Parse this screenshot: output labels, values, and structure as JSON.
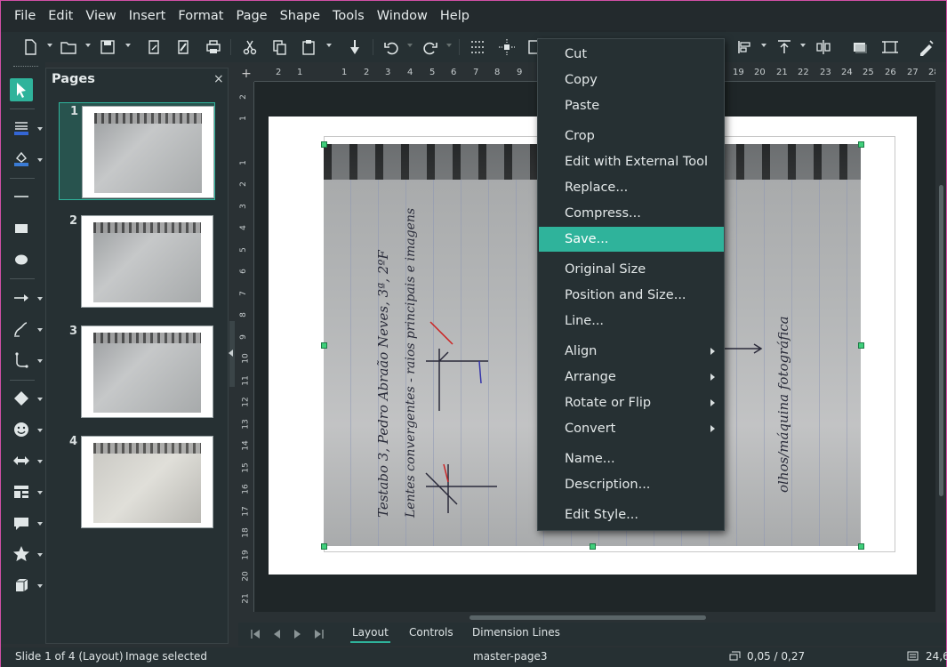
{
  "menubar": {
    "items": [
      "File",
      "Edit",
      "View",
      "Insert",
      "Format",
      "Page",
      "Shape",
      "Tools",
      "Window",
      "Help"
    ]
  },
  "toolbar": {
    "icons": [
      "new-icon",
      "open-icon",
      "save-icon",
      "export-icon",
      "export-pdf-icon",
      "print-icon",
      "cut-icon",
      "copy-icon",
      "paste-icon",
      "clone-formatting-icon",
      "undo-icon",
      "redo-icon",
      "grid-icon",
      "helplines-icon",
      "zoom-icon",
      "align-icon",
      "arrange-icon",
      "distribute-icon",
      "shadow-icon",
      "crop-icon",
      "transform-icon"
    ]
  },
  "tools": {
    "icons": [
      "select-icon",
      "line-color-icon",
      "fill-color-icon",
      "line-icon",
      "rectangle-icon",
      "ellipse-icon",
      "arrow-line-icon",
      "curve-icon",
      "connector-icon",
      "diamond-icon",
      "smiley-icon",
      "double-arrow-icon",
      "flowchart-icon",
      "callout-icon",
      "star-icon",
      "3d-cube-icon"
    ]
  },
  "pages_panel": {
    "title": "Pages",
    "close": "×",
    "thumbnails": [
      {
        "number": "1",
        "selected": true
      },
      {
        "number": "2",
        "selected": false
      },
      {
        "number": "3",
        "selected": false
      },
      {
        "number": "4",
        "selected": false
      }
    ]
  },
  "rulers": {
    "horizontal": [
      "2",
      "1",
      "1",
      "2",
      "3",
      "4",
      "5",
      "6",
      "7",
      "8",
      "9",
      "19",
      "20",
      "21",
      "22",
      "23",
      "24",
      "25",
      "26",
      "27",
      "28"
    ],
    "vertical": [
      "2",
      "1",
      "1",
      "2",
      "3",
      "4",
      "5",
      "6",
      "7",
      "8",
      "9",
      "10",
      "11",
      "12",
      "13",
      "14",
      "15",
      "16",
      "17",
      "18",
      "19",
      "20",
      "21"
    ]
  },
  "image": {
    "handwriting_title": "Testabo 3, Pedro Abraão Neves, 3ª, 2ºF",
    "handwriting_subtitle": "Lentes convergentes - raios principais e imagens",
    "handwriting_right": "olhos/máquina fotográfica"
  },
  "context_menu": {
    "items": [
      {
        "label": "Cut"
      },
      {
        "label": "Copy"
      },
      {
        "label": "Paste"
      },
      {
        "label": "Crop"
      },
      {
        "label": "Edit with External Tool"
      },
      {
        "label": "Replace..."
      },
      {
        "label": "Compress..."
      },
      {
        "label": "Save...",
        "highlighted": true
      },
      {
        "label": "Original Size"
      },
      {
        "label": "Position and Size..."
      },
      {
        "label": "Line..."
      },
      {
        "label": "Align",
        "submenu": true
      },
      {
        "label": "Arrange",
        "submenu": true
      },
      {
        "label": "Rotate or Flip",
        "submenu": true
      },
      {
        "label": "Convert",
        "submenu": true
      },
      {
        "label": "Name..."
      },
      {
        "label": "Description..."
      },
      {
        "label": "Edit Style..."
      }
    ]
  },
  "tabs": {
    "items": [
      "Layout",
      "Controls",
      "Dimension Lines"
    ],
    "active": "Layout"
  },
  "statusbar": {
    "slide_info": "Slide 1 of 4 (Layout)",
    "selection": "Image selected",
    "master": "master-page3",
    "position": "0,05 / 0,27",
    "size": "24,6"
  },
  "colors": {
    "accent": "#2fb39b",
    "background": "#263033",
    "handle": "#3fcf7a"
  }
}
